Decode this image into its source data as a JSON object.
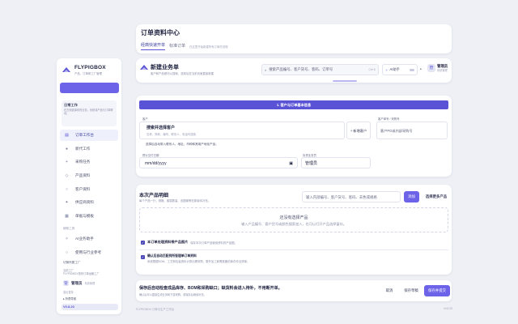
{
  "sidebar": {
    "brand_name": "FLYPIGBOX",
    "brand_sub": "产品、订单和工厂管理",
    "new_button": "",
    "tip_title": "日常工作",
    "tip_text": "在左侧选择你的业务，系统将产品与订单联动。",
    "items": [
      {
        "label": "订单工作台",
        "icon": "document-icon",
        "active": true
      },
      {
        "label": "新代工作",
        "icon": "dot-icon",
        "active": false
      },
      {
        "label": "采购任务",
        "icon": "plus-icon",
        "active": false
      },
      {
        "label": "产品资料",
        "icon": "cube-icon",
        "active": false
      },
      {
        "label": "客户资料",
        "icon": "circle-icon",
        "active": false
      },
      {
        "label": "供应商资料",
        "icon": "star-icon",
        "active": false
      },
      {
        "label": "单据与模板",
        "icon": "grid-icon",
        "active": false
      }
    ],
    "section2": "辅助工具",
    "items2": [
      {
        "label": "AI业务助手",
        "icon": "spark-icon"
      },
      {
        "label": "使用与行业参考",
        "icon": "circle-icon"
      }
    ],
    "workspace_label": "切换所属工厂",
    "workspace_info": "当前工厂\nFLYPIGBOX是你订单运输工厂",
    "user_name": "管理员",
    "user_role": "系统管理",
    "footer1": "退出登录",
    "footer2": "▸ 折叠导航",
    "version": "V0.8.20"
  },
  "header": {
    "title": "订单资料中心",
    "tabs": [
      {
        "label": "经典快速开单",
        "active": true
      },
      {
        "label": "标准订单",
        "active": false
      }
    ],
    "tab_hint": "在这里开始新建所有订单的流程"
  },
  "bar": {
    "title": "新建业务单",
    "subtitle": "客户和产品都可以搜索，选择后在当前页面直接新建",
    "search_placeholder": "搜索产品编号、客户货号、客码、订单号",
    "search_shortcut": "Ctrl K",
    "ai_label": "AI助手",
    "user_name": "管理员",
    "user_role": "系统管理"
  },
  "customer": {
    "header": "1. 客户与订单基本信息",
    "customer_label": "客户",
    "customer_title": "搜索并选择客户",
    "customer_desc": "名称、简称、编号、联系人、电话均搜索",
    "add_button": "+ 新增客户",
    "hint": "选择后自动带入联系人、地址、币种和常用产地化产品。",
    "po_label": "客户单号 / 采购号",
    "po_placeholder": "客户PO或内部采购号",
    "date_label": "预计交付日期",
    "date_value": "mm/dd/yyyy",
    "owner_label": "负责业务员",
    "owner_value": "管理员"
  },
  "products": {
    "title": "本次产品明细",
    "subtitle": "每个产品一行，规格、客属数量、含图案等在新版本补充。",
    "search_placeholder": "输入内部编号、客户货号、客码、去色或规格",
    "add_button": "添加",
    "more_button": "选择更多产品",
    "empty_title": "还没有选择产品",
    "empty_desc": "输入产品编号、客户货号或颜色搜索加入，也可以打开产品选择窗口。",
    "check1_title": "本订单处理资料带产品图片",
    "check1_desc": "保存本次订单产品使用资料的产品图。",
    "check2_title": "确认后自动匹配到所管理单订单资料",
    "check2_desc": "系统根据BOM、工艺和包装资料计算出需采购、委外加工和需准备的库存作业清单。"
  },
  "footer": {
    "title": "保存后自动检查成品库存、BOM和采购缺口；缺货料会进入待补，不用断开单。",
    "desc": "确认后可以直接生成业务和下游采购，或保存后继续补充。",
    "cancel": "取消",
    "save_draft": "保存草稿",
    "submit": "保存并提交",
    "credits": "FLYPIGBOX 订单与生产工作台",
    "credits_right": "v0.8.20"
  },
  "colors": {
    "accent": "#6d63e8",
    "accent_dark": "#4b47b8",
    "background": "#eef0f5"
  }
}
